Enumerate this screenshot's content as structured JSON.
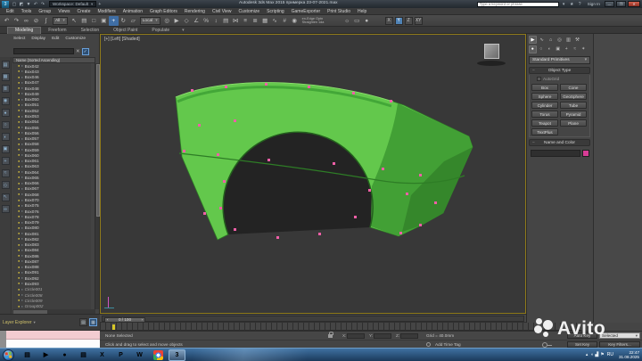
{
  "title_bar": {
    "app_icon_glyph": "3",
    "workspace_label": "Workspace: Default",
    "new_tab": "+",
    "title": "Autodesk 3ds Max 2015   примерка 23-07-2021.max",
    "search_placeholder": "Type a keyword or phrase",
    "sign_in": "Sign In",
    "minimize": "—",
    "maximize": "❐",
    "close": "✕"
  },
  "menu_bar": {
    "items": [
      "Edit",
      "Tools",
      "Group",
      "Views",
      "Create",
      "Modifiers",
      "Animation",
      "Graph Editors",
      "Rendering",
      "Civil View",
      "Customize",
      "Scripting",
      "GameExporter",
      "Print Studio",
      "Help"
    ]
  },
  "main_toolbar": {
    "select_filter": "All",
    "coord_system": "Local",
    "icons_left": [
      {
        "name": "undo-icon",
        "glyph": "↶"
      },
      {
        "name": "redo-icon",
        "glyph": "↷"
      },
      {
        "name": "select-and-link-icon",
        "glyph": "∞"
      },
      {
        "name": "unlink-selection-icon",
        "glyph": "⊘"
      },
      {
        "name": "bind-to-space-warp-icon",
        "glyph": "∫"
      }
    ],
    "icons_select": [
      {
        "name": "select-object-icon",
        "glyph": "↖"
      },
      {
        "name": "select-by-name-icon",
        "glyph": "▤"
      },
      {
        "name": "selection-region-icon",
        "glyph": "□"
      },
      {
        "name": "window-crossing-icon",
        "glyph": "▣"
      }
    ],
    "icons_transform": [
      {
        "name": "select-and-move-icon",
        "glyph": "+",
        "cls": "active"
      },
      {
        "name": "select-and-rotate-icon",
        "glyph": "↻"
      },
      {
        "name": "select-and-scale-icon",
        "glyph": "▱"
      }
    ],
    "icons_mid": [
      {
        "name": "use-pivot-center-icon",
        "glyph": "◎"
      },
      {
        "name": "select-and-manipulate-icon",
        "glyph": "▶"
      },
      {
        "name": "snaps-toggle-icon",
        "glyph": "◇"
      },
      {
        "name": "angle-snap-icon",
        "glyph": "∠"
      },
      {
        "name": "percent-snap-icon",
        "glyph": "%"
      },
      {
        "name": "spinner-snap-icon",
        "glyph": "↕"
      },
      {
        "name": "named-selection-sets-icon",
        "glyph": "▤"
      },
      {
        "name": "mirror-icon",
        "glyph": "⋈"
      },
      {
        "name": "align-icon",
        "glyph": "≡"
      },
      {
        "name": "layer-manager-icon",
        "glyph": "≣"
      },
      {
        "name": "ribbon-toggle-icon",
        "glyph": "▦"
      },
      {
        "name": "curve-editor-icon",
        "glyph": "∿"
      },
      {
        "name": "schematic-view-icon",
        "glyph": "#"
      },
      {
        "name": "material-editor-icon",
        "glyph": "◉"
      }
    ],
    "note_line1": "en-Edge Optn",
    "note_line2": "Straighten 1da",
    "icons_right": [
      {
        "name": "render-setup-icon",
        "glyph": "☼"
      },
      {
        "name": "rendered-frame-window-icon",
        "glyph": "▭"
      },
      {
        "name": "render-production-icon",
        "glyph": "●"
      }
    ],
    "axis_constraints": [
      {
        "label": "X"
      },
      {
        "label": "Y",
        "cls": "active"
      },
      {
        "label": "Z"
      },
      {
        "label": "XY"
      }
    ]
  },
  "ribbon": {
    "tabs": [
      {
        "label": "Modeling",
        "cls": "active"
      },
      {
        "label": "Freeform"
      },
      {
        "label": "Selection"
      },
      {
        "label": "Object Paint"
      },
      {
        "label": "Populate"
      }
    ],
    "caret": "▾"
  },
  "scene_explorer": {
    "menu": [
      "Select",
      "Display",
      "Edit",
      "Customize"
    ],
    "clear_search": "✕",
    "column_header": "Name (Sorted Ascending)",
    "footer_label": "Layer Explorer",
    "side_icons": [
      {
        "name": "se-display-hierarchy-icon",
        "glyph": "▤"
      },
      {
        "name": "se-display-objects-icon",
        "glyph": "▦"
      },
      {
        "name": "se-display-layers-icon",
        "glyph": "≣"
      },
      {
        "name": "se-display-materials-icon",
        "glyph": "◉"
      },
      {
        "name": "se-filter-geometry-icon",
        "glyph": "●"
      },
      {
        "name": "se-filter-shapes-icon",
        "glyph": "○"
      },
      {
        "name": "se-filter-lights-icon",
        "glyph": "◐"
      },
      {
        "name": "se-filter-cameras-icon",
        "glyph": "▣"
      },
      {
        "name": "se-filter-helpers-icon",
        "glyph": "+"
      },
      {
        "name": "se-filter-spacewarps-icon",
        "glyph": "≈"
      },
      {
        "name": "se-lock-selection-icon",
        "glyph": "◇"
      },
      {
        "name": "se-pick-parent-icon",
        "glyph": "↖"
      },
      {
        "name": "se-sync-selection-icon",
        "glyph": "∞"
      }
    ],
    "items": [
      {
        "name": "Box042",
        "kind": "kind-box"
      },
      {
        "name": "Box043",
        "kind": "kind-box"
      },
      {
        "name": "Box046",
        "kind": "kind-box"
      },
      {
        "name": "Box047",
        "kind": "kind-box"
      },
      {
        "name": "Box048",
        "kind": "kind-box"
      },
      {
        "name": "Box049",
        "kind": "kind-box"
      },
      {
        "name": "Box050",
        "kind": "kind-box"
      },
      {
        "name": "Box051",
        "kind": "kind-box"
      },
      {
        "name": "Box052",
        "kind": "kind-box"
      },
      {
        "name": "Box053",
        "kind": "kind-box"
      },
      {
        "name": "Box054",
        "kind": "kind-box"
      },
      {
        "name": "Box055",
        "kind": "kind-box"
      },
      {
        "name": "Box056",
        "kind": "kind-box"
      },
      {
        "name": "Box057",
        "kind": "kind-box"
      },
      {
        "name": "Box058",
        "kind": "kind-box"
      },
      {
        "name": "Box059",
        "kind": "kind-box"
      },
      {
        "name": "Box060",
        "kind": "kind-box"
      },
      {
        "name": "Box061",
        "kind": "kind-box"
      },
      {
        "name": "Box063",
        "kind": "kind-box"
      },
      {
        "name": "Box064",
        "kind": "kind-box"
      },
      {
        "name": "Box065",
        "kind": "kind-box"
      },
      {
        "name": "Box066",
        "kind": "kind-box"
      },
      {
        "name": "Box067",
        "kind": "kind-box"
      },
      {
        "name": "Box068",
        "kind": "kind-box"
      },
      {
        "name": "Box070",
        "kind": "kind-box"
      },
      {
        "name": "Box075",
        "kind": "kind-box"
      },
      {
        "name": "Box076",
        "kind": "kind-box"
      },
      {
        "name": "Box078",
        "kind": "kind-box"
      },
      {
        "name": "Box079",
        "kind": "kind-box"
      },
      {
        "name": "Box080",
        "kind": "kind-box"
      },
      {
        "name": "Box081",
        "kind": "kind-box"
      },
      {
        "name": "Box082",
        "kind": "kind-box"
      },
      {
        "name": "Box083",
        "kind": "kind-box"
      },
      {
        "name": "Box084",
        "kind": "kind-box"
      },
      {
        "name": "Box086",
        "kind": "kind-box"
      },
      {
        "name": "Box087",
        "kind": "kind-box"
      },
      {
        "name": "Box088",
        "kind": "kind-box"
      },
      {
        "name": "Box091",
        "kind": "kind-box"
      },
      {
        "name": "Box092",
        "kind": "kind-box"
      },
      {
        "name": "Box093",
        "kind": "kind-box"
      },
      {
        "name": "Circle001",
        "kind": "kind-circle"
      },
      {
        "name": "Circle008",
        "kind": "kind-circle"
      },
      {
        "name": "Circle009",
        "kind": "kind-circle"
      },
      {
        "name": "Group002",
        "kind": "kind-group"
      }
    ]
  },
  "viewport": {
    "label": "[+] [Left] [Shaded]",
    "model": {
      "color": "#63c84c",
      "color_dark": "#42a035",
      "color_darker": "#35872b",
      "arch_color": "#232323",
      "vertex_color": "#ef5fa7",
      "vertices": [
        [
          102,
          62
        ],
        [
          140,
          58
        ],
        [
          185,
          55
        ],
        [
          233,
          58
        ],
        [
          283,
          65
        ],
        [
          325,
          74
        ],
        [
          110,
          101
        ],
        [
          150,
          96
        ],
        [
          93,
          130
        ],
        [
          131,
          134
        ],
        [
          188,
          140
        ],
        [
          261,
          144
        ],
        [
          316,
          150
        ],
        [
          358,
          157
        ],
        [
          138,
          164
        ],
        [
          134,
          194
        ],
        [
          150,
          218
        ],
        [
          198,
          227
        ],
        [
          245,
          223
        ],
        [
          285,
          204
        ],
        [
          301,
          174
        ],
        [
          343,
          178
        ],
        [
          375,
          188
        ],
        [
          336,
          222
        ],
        [
          358,
          213
        ],
        [
          116,
          200
        ]
      ]
    }
  },
  "command_panel": {
    "tabs": [
      {
        "name": "tab-create-icon",
        "glyph": "▶",
        "cls": "active"
      },
      {
        "name": "tab-modify-icon",
        "glyph": "∿"
      },
      {
        "name": "tab-hierarchy-icon",
        "glyph": "⌂"
      },
      {
        "name": "tab-motion-icon",
        "glyph": "◎"
      },
      {
        "name": "tab-display-icon",
        "glyph": "▥"
      },
      {
        "name": "tab-utilities-icon",
        "glyph": "⚒"
      }
    ],
    "categories": [
      {
        "name": "cat-geometry-icon",
        "glyph": "●",
        "cls": "active"
      },
      {
        "name": "cat-shapes-icon",
        "glyph": "○"
      },
      {
        "name": "cat-lights-icon",
        "glyph": "◐"
      },
      {
        "name": "cat-cameras-icon",
        "glyph": "▣"
      },
      {
        "name": "cat-helpers-icon",
        "glyph": "+"
      },
      {
        "name": "cat-spacewarps-icon",
        "glyph": "≈"
      },
      {
        "name": "cat-systems-icon",
        "glyph": "✶"
      }
    ],
    "dropdown_value": "Standard Primitives",
    "object_type_title": "Object Type",
    "autogrid_label": "AutoGrid",
    "buttons": [
      "Box",
      "Cone",
      "Sphere",
      "GeoSphere",
      "Cylinder",
      "Tube",
      "Torus",
      "Pyramid",
      "Teapot",
      "Plane",
      "TextPlus"
    ],
    "name_color_title": "Name and Color",
    "object_color": "#d83d96"
  },
  "timeline": {
    "prev": "‹",
    "slider_label": "0 / 100",
    "next": "›"
  },
  "status_bar": {
    "selection_status": "None Selected",
    "prompt": "Click and drag to select and move objects",
    "coord_labels": [
      "X:",
      "Y:",
      "Z:"
    ],
    "grid_label": "Grid = 40.0mm",
    "add_time_tag": "Add Time Tag",
    "auto_key": "Auto Key",
    "keying_set": "Selected",
    "set_key": "Set Key",
    "key_filters": "Key Filters..."
  },
  "watermark": {
    "text": "Avito"
  },
  "taskbar": {
    "apps": [
      {
        "name": "taskbar-explorer-icon",
        "glyph": "▤",
        "bg": "#e7c14f",
        "fg": "#6e5212"
      },
      {
        "name": "taskbar-media-player-icon",
        "glyph": "▶",
        "bg": "#27547e",
        "fg": "#bfe6ff"
      },
      {
        "name": "taskbar-app-red-icon",
        "glyph": "●",
        "bg": "#e8e8e8",
        "fg": "#d23b2f"
      },
      {
        "name": "taskbar-document-icon",
        "glyph": "▤",
        "bg": "#f4f6f8",
        "fg": "#4a78b5"
      },
      {
        "name": "taskbar-excel-icon",
        "glyph": "X",
        "bg": "#1e6e43",
        "fg": "#ffffff"
      },
      {
        "name": "taskbar-powerpoint-icon",
        "glyph": "P",
        "bg": "#c4442a",
        "fg": "#ffffff"
      },
      {
        "name": "taskbar-word-icon",
        "glyph": "W",
        "bg": "#2b579a",
        "fg": "#ffffff"
      },
      {
        "name": "taskbar-chrome-icon",
        "glyph": "",
        "cls": "chrome-tile",
        "bg": "",
        "fg": ""
      },
      {
        "name": "taskbar-3dsmax-icon",
        "glyph": "3",
        "bg": "#1d3d52",
        "fg": "#49c8d2",
        "tile_cls": "active"
      }
    ],
    "tray": {
      "expand": "▴",
      "icons": [
        {
          "name": "tray-volume-icon",
          "glyph": "◖"
        },
        {
          "name": "tray-network-icon",
          "glyph": "▟"
        },
        {
          "name": "tray-flag-icon",
          "glyph": "⚑"
        }
      ],
      "lang": "RU",
      "time": "22:47",
      "date": "31.08.2025"
    }
  }
}
